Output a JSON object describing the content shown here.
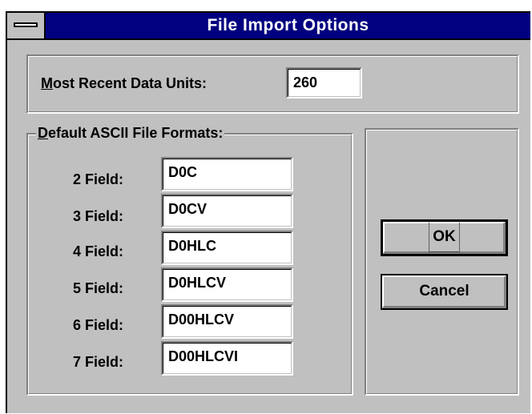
{
  "window": {
    "title": "File Import Options"
  },
  "recent": {
    "label_key": "M",
    "label_rest": "ost Recent Data Units:",
    "value": "260"
  },
  "formats": {
    "group_key": "D",
    "group_rest": "efault ASCII File Formats:",
    "rows": [
      {
        "label": "2 Field:",
        "value": "D0C"
      },
      {
        "label": "3 Field:",
        "value": "D0CV"
      },
      {
        "label": "4 Field:",
        "value": "D0HLC"
      },
      {
        "label": "5 Field:",
        "value": "D0HLCV"
      },
      {
        "label": "6 Field:",
        "value": "D00HLCV"
      },
      {
        "label": "7 Field:",
        "value": "D00HLCVI"
      }
    ]
  },
  "buttons": {
    "ok": "OK",
    "cancel": "Cancel"
  }
}
